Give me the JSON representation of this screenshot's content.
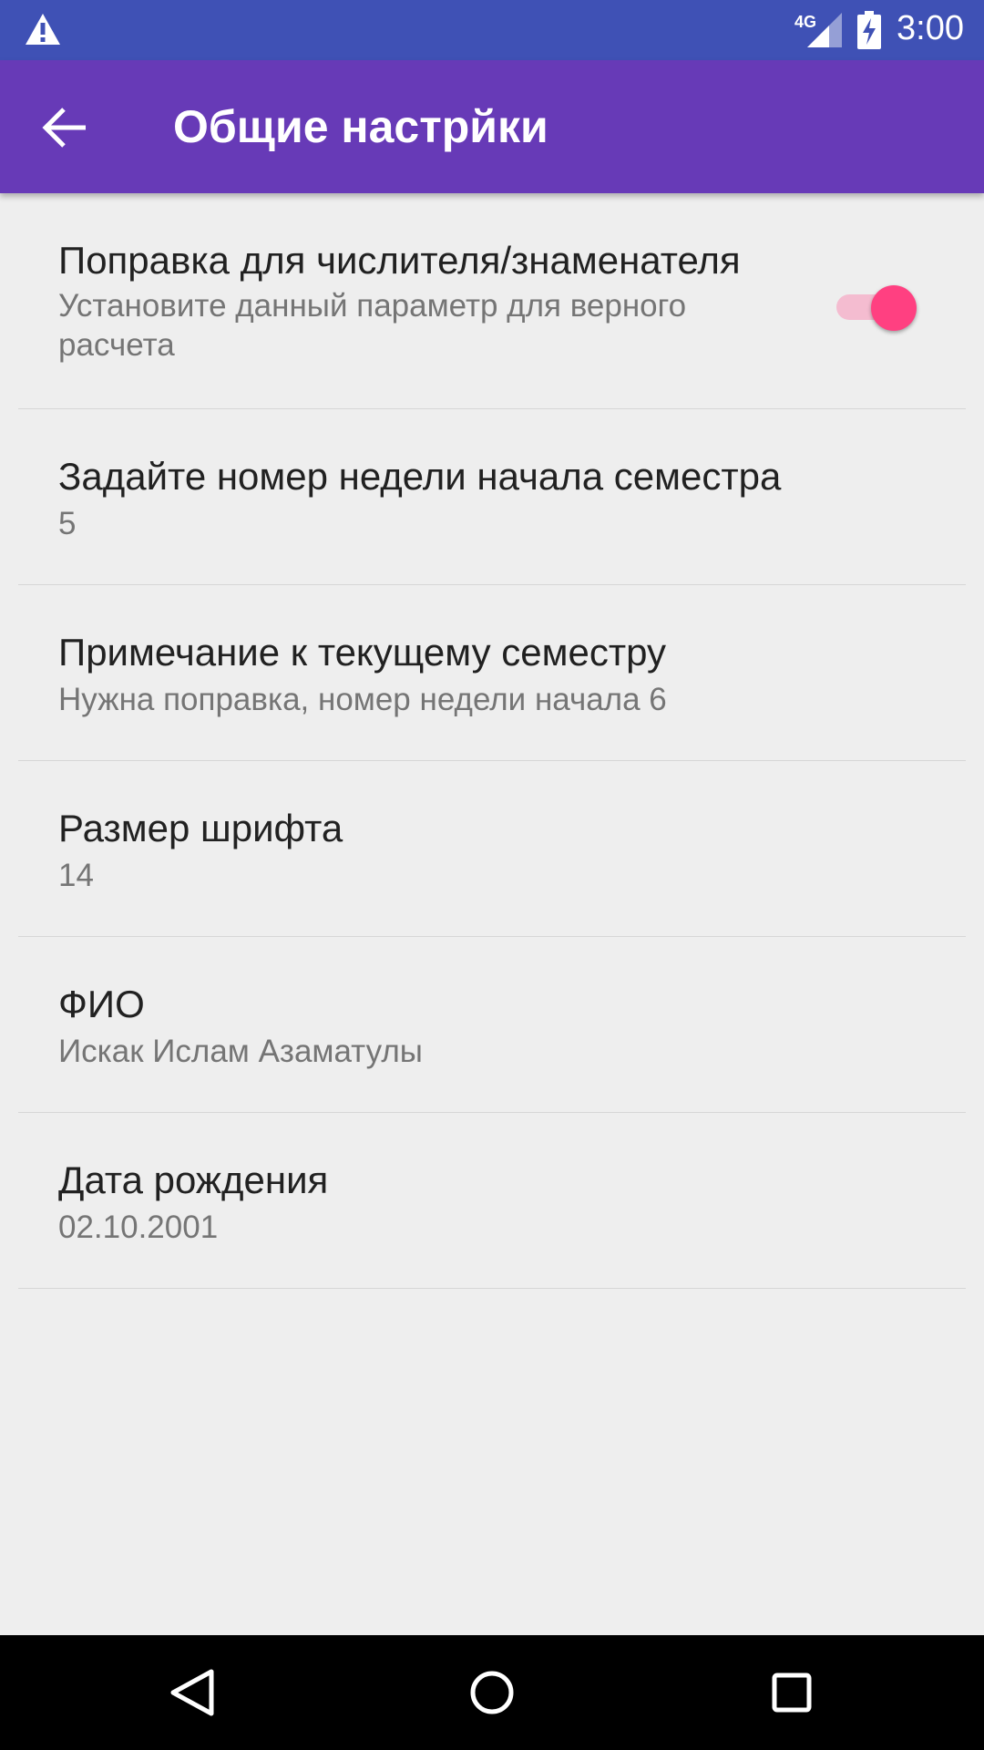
{
  "status_bar": {
    "time": "3:00",
    "network": "4G",
    "icons": [
      "warning-icon",
      "signal-icon",
      "battery-charging-icon"
    ]
  },
  "app_bar": {
    "title": "Общие настрйки",
    "back_icon": "arrow-back-icon",
    "color": "#673ab7"
  },
  "settings": {
    "items": [
      {
        "title": "Поправка для числителя/знаменателя",
        "summary": "Установите данный параметр для верного расчета",
        "toggle": true
      },
      {
        "title": "Задайте номер недели начала семестра",
        "summary": "5"
      },
      {
        "title": "Примечание к текущему семестру",
        "summary": "Нужна поправка, номер недели начала 6"
      },
      {
        "title": "Размер шрифта",
        "summary": "14"
      },
      {
        "title": "ФИО",
        "summary": "Искак Ислам Азаматулы"
      },
      {
        "title": "Дата рождения",
        "summary": "02.10.2001"
      }
    ]
  },
  "nav_bar": {
    "icons": [
      "back-triangle-icon",
      "home-circle-icon",
      "recents-square-icon"
    ]
  },
  "colors": {
    "status_bar": "#3f51b5",
    "accent": "#ff4081",
    "background": "#eeeeee"
  }
}
